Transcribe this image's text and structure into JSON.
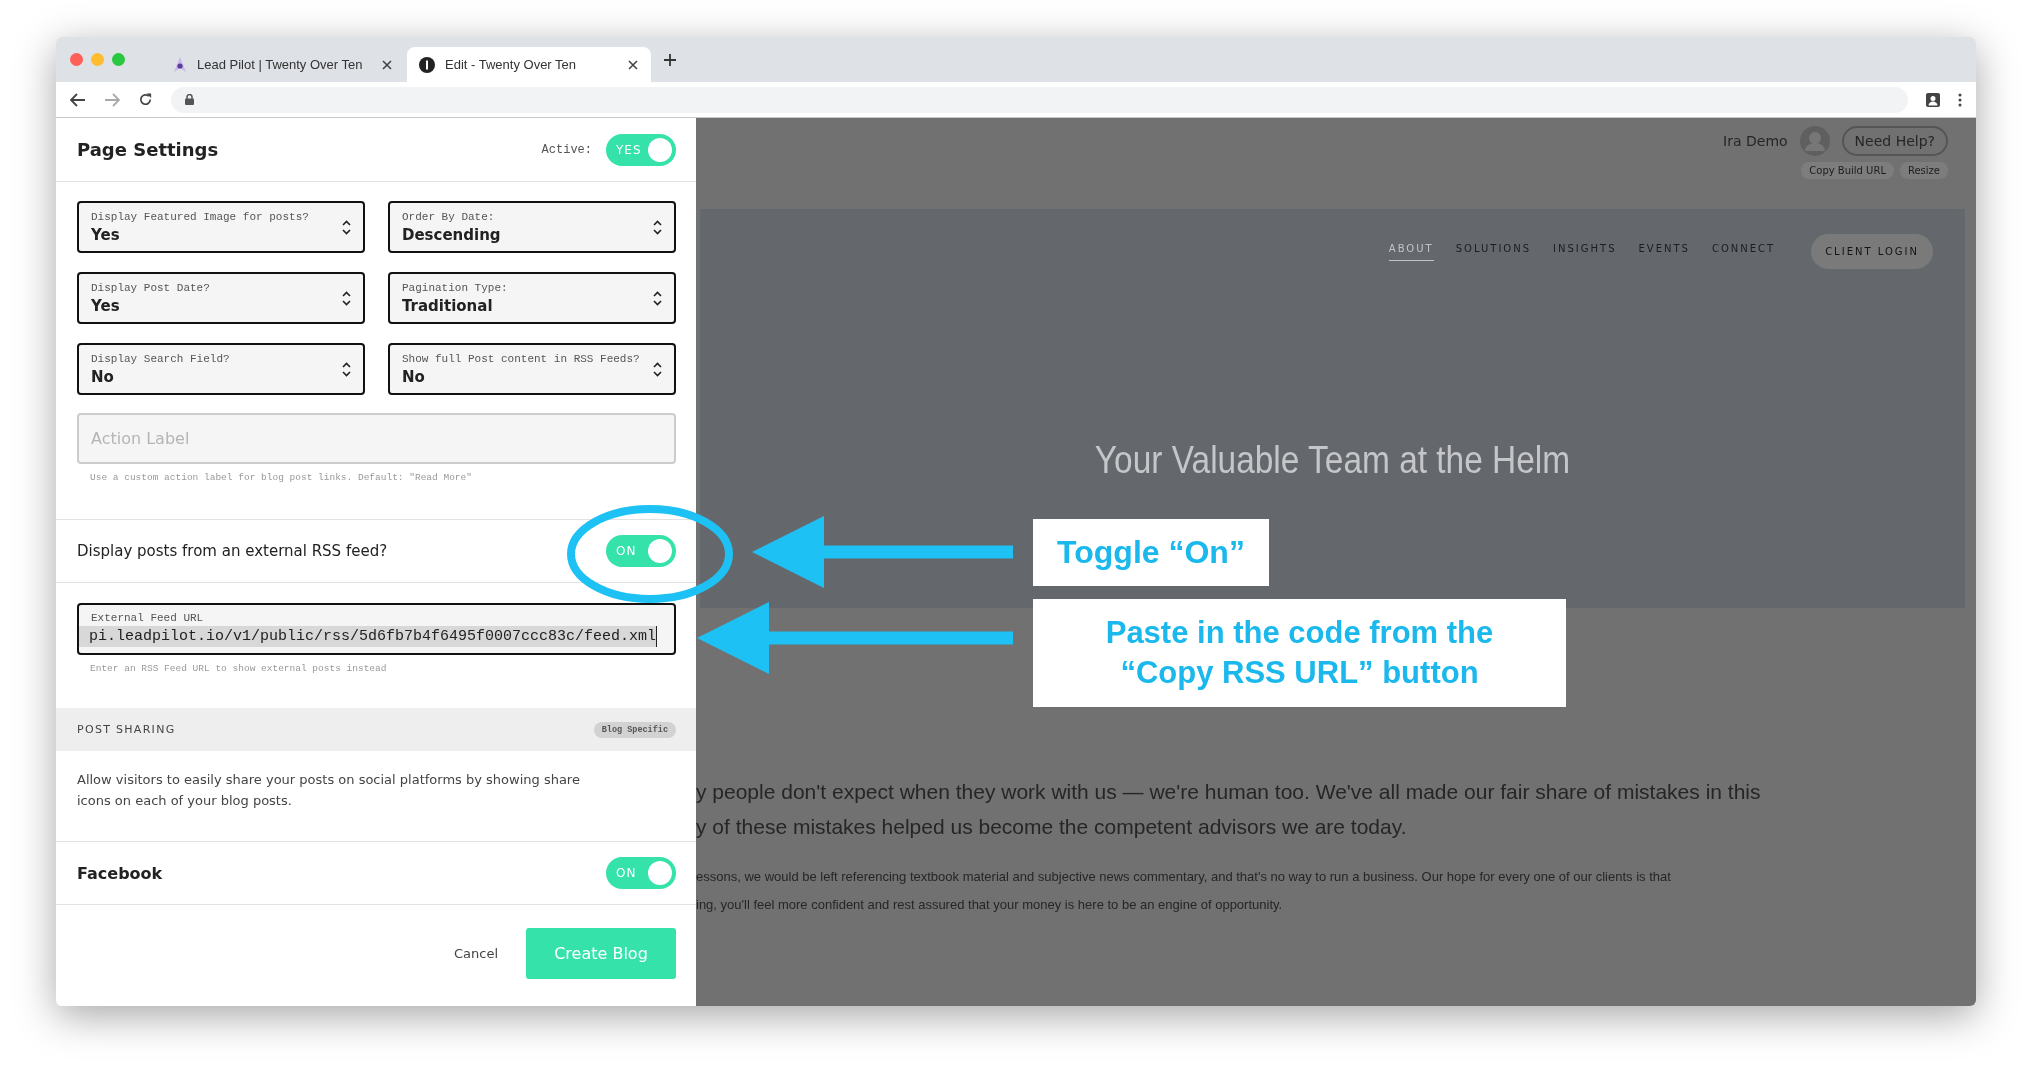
{
  "browser": {
    "tabs": [
      {
        "title": "Lead Pilot | Twenty Over Ten",
        "selected": false
      },
      {
        "title": "Edit - Twenty Over Ten",
        "selected": true
      }
    ]
  },
  "panel": {
    "title": "Page Settings",
    "active": {
      "label": "Active:",
      "on": true,
      "text": "YES"
    },
    "selects": [
      {
        "label": "Display Featured Image for posts?",
        "value": "Yes"
      },
      {
        "label": "Order By Date:",
        "value": "Descending"
      },
      {
        "label": "Display Post Date?",
        "value": "Yes"
      },
      {
        "label": "Pagination Type:",
        "value": "Traditional"
      },
      {
        "label": "Display Search Field?",
        "value": "No"
      },
      {
        "label": "Show full Post content in RSS Feeds?",
        "value": "No"
      }
    ],
    "action_label": {
      "placeholder": "Action Label",
      "help": "Use a custom action label for blog post links. Default: \"Read More\""
    },
    "rss_toggle": {
      "label": "Display posts from an external RSS feed?",
      "on": true,
      "text": "ON"
    },
    "feed_url": {
      "label": "External Feed URL",
      "value": "pi.leadpilot.io/v1/public/rss/5d6fb7b4f6495f0007ccc83c/feed.xml",
      "help": "Enter an RSS Feed URL to show external posts instead"
    },
    "post_sharing": {
      "heading": "POST SHARING",
      "badge": "Blog Specific",
      "description": "Allow visitors to easily share your posts on social platforms by showing share icons on each of your blog posts."
    },
    "facebook": {
      "label": "Facebook",
      "on": true,
      "text": "ON"
    },
    "buttons": {
      "cancel": "Cancel",
      "create": "Create Blog"
    }
  },
  "site": {
    "user": "Ira Demo",
    "help_button": "Need Help?",
    "tools": [
      "Copy Build URL",
      "Resize"
    ],
    "nav": [
      {
        "label": "ABOUT",
        "selected": true
      },
      {
        "label": "SOLUTIONS",
        "selected": false
      },
      {
        "label": "INSIGHTS",
        "selected": false
      },
      {
        "label": "EVENTS",
        "selected": false
      },
      {
        "label": "CONNECT",
        "selected": false
      }
    ],
    "login": "CLIENT LOGIN",
    "heading": "Your Valuable Team at the Helm",
    "lead": [
      "y people don't expect when they work with us — we're human too. We've all made our fair share of mistakes in this",
      "y of these mistakes helped us become the competent advisors we are today."
    ],
    "body": [
      "essons, we would be left referencing textbook material and subjective news commentary, and that's no way to run a business. Our hope for every one of our clients is that",
      "ing, you'll feel more confident and rest assured that your money is here to be an engine of opportunity."
    ]
  },
  "callouts": [
    "Toggle “On”",
    "Paste in the code from the\n“Copy RSS URL” button"
  ]
}
